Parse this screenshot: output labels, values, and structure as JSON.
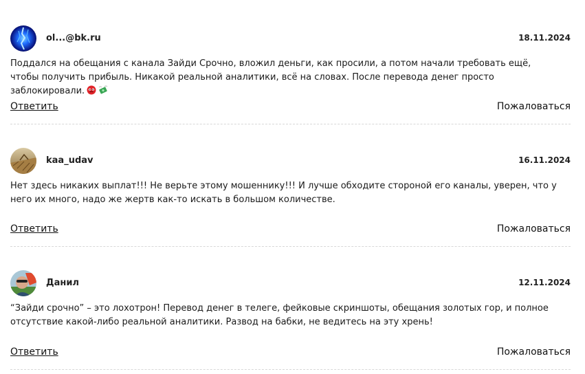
{
  "comments": [
    {
      "author": "ol...@bk.ru",
      "date": "18.11.2024",
      "text": "Поддался на обещания с канала Зайди Срочно, вложил деньги, как просили, а потом начали требовать ещё, чтобы получить прибыль. Никакой реальной аналитики, всё на словах. После перевода денег просто заблокировали.",
      "emojis": [
        "angry-face-emoji",
        "money-with-wings-emoji"
      ],
      "reply_label": "Ответить",
      "report_label": "Пожаловаться"
    },
    {
      "author": "kaa_udav",
      "date": "16.11.2024",
      "text": "Нет здесь никаких выплат!!! Не верьте этому мошеннику!!! И лучше обходите стороной его каналы, уверен, что у него их много, надо же жертв как-то искать в большом количестве.",
      "reply_label": "Ответить",
      "report_label": "Пожаловаться"
    },
    {
      "author": "Данил",
      "date": "12.11.2024",
      "text": "“Зайди срочно” – это лохотрон! Перевод денег в телеге, фейковые скриншоты, обещания золотых гор, и полное отсутствие какой-либо реальной аналитики. Развод на бабки, не ведитесь на эту хрень!",
      "reply_label": "Ответить",
      "report_label": "Пожаловаться"
    }
  ],
  "colors": {
    "text": "#1a1a1a",
    "divider": "#d8d8d8",
    "background": "#ffffff"
  }
}
